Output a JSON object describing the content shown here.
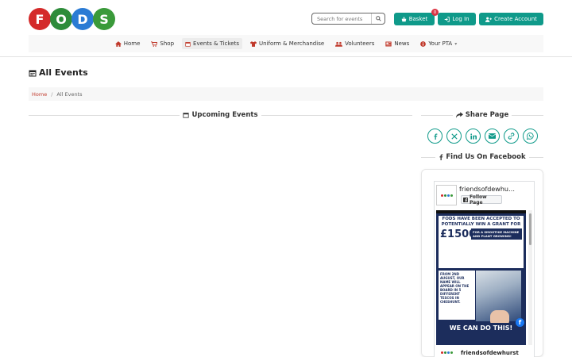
{
  "header": {
    "logo_letters": [
      "F",
      "O",
      "D",
      "S"
    ],
    "search_placeholder": "Search for events",
    "basket_label": "Basket",
    "basket_count": "0",
    "login_label": "Log In",
    "create_account_label": "Create Account"
  },
  "nav": {
    "items": [
      {
        "label": "Home",
        "icon": "home-icon"
      },
      {
        "label": "Shop",
        "icon": "cart-icon"
      },
      {
        "label": "Events & Tickets",
        "icon": "calendar-icon",
        "active": true
      },
      {
        "label": "Uniform & Merchandise",
        "icon": "shirt-icon"
      },
      {
        "label": "Volunteers",
        "icon": "users-icon"
      },
      {
        "label": "News",
        "icon": "newspaper-icon"
      },
      {
        "label": "Your PTA",
        "icon": "info-icon",
        "dropdown": true
      }
    ]
  },
  "main": {
    "title": "All Events",
    "breadcrumb": {
      "home": "Home",
      "separator": "/",
      "current": "All Events"
    },
    "upcoming_heading": "Upcoming Events"
  },
  "sidebar": {
    "share_heading": "Share Page",
    "share_icons": [
      "facebook-icon",
      "x-icon",
      "linkedin-icon",
      "email-icon",
      "link-icon",
      "whatsapp-icon"
    ],
    "facebook_heading": "Find Us On Facebook",
    "fb_page_name": "friendsofdewhu…",
    "fb_follow_label": "Follow Page",
    "fb_post_title": "FODS HAVE BEEN ACCEPTED TO POTENTIALLY WIN A GRANT FOR",
    "fb_post_amount": "£1500",
    "fb_post_sub": "FOR A SMOOTHIE MACHINE AND PLANT GROWING!",
    "fb_post_notes": "FROM 2ND AUGUST, OUR NAME WILL APPEAR ON THE BOARD IN 5 DIFFERENT TESCOS IN CHESHUNT.",
    "fb_post_banner": "WE CAN DO THIS!",
    "fb_footer_name": "friendsofdewhurst"
  },
  "colors": {
    "accent": "#0f9a8a",
    "nav_icon": "#c0392b",
    "badge": "#dc3545",
    "facebook": "#1877f2",
    "post_bg": "#1c2d5c"
  }
}
